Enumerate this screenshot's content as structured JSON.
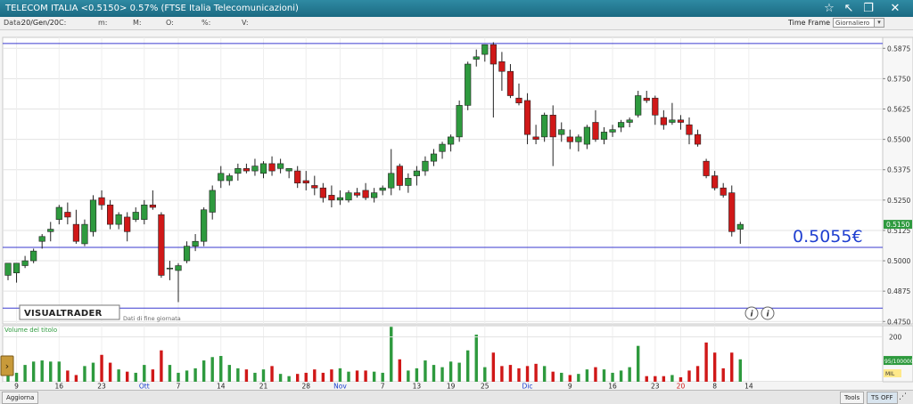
{
  "window": {
    "title": "TELECOM ITALIA <0.5150> 0.57% (FTSE Italia Telecomunicazioni)",
    "icons": [
      "star-icon",
      "pin-icon",
      "restore-icon",
      "close-icon"
    ]
  },
  "infobar": {
    "data_label": "Data:",
    "data_value": "20/Gen/20",
    "c_label": "C:",
    "m_label": "m:",
    "M_label": "M:",
    "o_label": "O:",
    "pct_label": "%:",
    "v_label": "V:",
    "timeframe_label": "Time Frame",
    "timeframe_value": "Giornaliero"
  },
  "overlay": {
    "brand": "VISUALTRADER",
    "note": "Dati di fine giornata",
    "price_callout": "0.5055€",
    "info_glyph": "i"
  },
  "statusbar": {
    "update_label": "Aggiorna",
    "tools_label": "Tools",
    "tsoff_label": "TS OFF"
  },
  "chart_data": {
    "type": "candlestick",
    "price_axis": {
      "ticks": [
        "0.5875",
        "0.5750",
        "0.5625",
        "0.5500",
        "0.5375",
        "0.5250",
        "0.5125",
        "0.5000",
        "0.4875",
        "0.4750"
      ],
      "ylim": [
        0.474,
        0.592
      ],
      "last_price_label": "0.5150"
    },
    "hlines": [
      0.5895,
      0.5055,
      0.4805
    ],
    "volume_panel": {
      "title": "Volume del titolo",
      "ticks": [
        "200"
      ],
      "ylim": [
        0,
        250
      ],
      "last_label": "95/100000",
      "unit_label": "MIL"
    },
    "x_labels": [
      {
        "text": "9",
        "i": 1
      },
      {
        "text": "16",
        "i": 6
      },
      {
        "text": "23",
        "i": 11
      },
      {
        "text": "Ott",
        "i": 16,
        "accent": true
      },
      {
        "text": "7",
        "i": 20
      },
      {
        "text": "14",
        "i": 25
      },
      {
        "text": "21",
        "i": 30
      },
      {
        "text": "28",
        "i": 35
      },
      {
        "text": "Nov",
        "i": 39,
        "accent": true
      },
      {
        "text": "7",
        "i": 44
      },
      {
        "text": "13",
        "i": 48
      },
      {
        "text": "19",
        "i": 52
      },
      {
        "text": "25",
        "i": 56
      },
      {
        "text": "Dic",
        "i": 61,
        "accent": true
      },
      {
        "text": "9",
        "i": 66
      },
      {
        "text": "16",
        "i": 71
      },
      {
        "text": "23",
        "i": 76
      },
      {
        "text": "20",
        "i": 79,
        "red": true
      },
      {
        "text": "8",
        "i": 83
      },
      {
        "text": "14",
        "i": 87
      }
    ],
    "candles": [
      {
        "o": 0.494,
        "h": 0.499,
        "l": 0.492,
        "c": 0.499,
        "v": 55
      },
      {
        "o": 0.495,
        "h": 0.499,
        "l": 0.491,
        "c": 0.499,
        "v": 40
      },
      {
        "o": 0.498,
        "h": 0.502,
        "l": 0.497,
        "c": 0.5,
        "v": 75
      },
      {
        "o": 0.5,
        "h": 0.505,
        "l": 0.499,
        "c": 0.504,
        "v": 90
      },
      {
        "o": 0.508,
        "h": 0.511,
        "l": 0.505,
        "c": 0.51,
        "v": 95
      },
      {
        "o": 0.512,
        "h": 0.516,
        "l": 0.508,
        "c": 0.513,
        "v": 90
      },
      {
        "o": 0.517,
        "h": 0.523,
        "l": 0.515,
        "c": 0.522,
        "v": 90
      },
      {
        "o": 0.52,
        "h": 0.524,
        "l": 0.515,
        "c": 0.518,
        "v": 50
      },
      {
        "o": 0.515,
        "h": 0.521,
        "l": 0.507,
        "c": 0.508,
        "v": 30
      },
      {
        "o": 0.507,
        "h": 0.517,
        "l": 0.506,
        "c": 0.515,
        "v": 70
      },
      {
        "o": 0.512,
        "h": 0.527,
        "l": 0.51,
        "c": 0.525,
        "v": 85
      },
      {
        "o": 0.526,
        "h": 0.529,
        "l": 0.521,
        "c": 0.523,
        "v": 120
      },
      {
        "o": 0.523,
        "h": 0.525,
        "l": 0.513,
        "c": 0.515,
        "v": 85
      },
      {
        "o": 0.515,
        "h": 0.52,
        "l": 0.513,
        "c": 0.519,
        "v": 55
      },
      {
        "o": 0.518,
        "h": 0.52,
        "l": 0.508,
        "c": 0.512,
        "v": 45
      },
      {
        "o": 0.517,
        "h": 0.522,
        "l": 0.516,
        "c": 0.52,
        "v": 40
      },
      {
        "o": 0.517,
        "h": 0.525,
        "l": 0.515,
        "c": 0.523,
        "v": 75
      },
      {
        "o": 0.523,
        "h": 0.529,
        "l": 0.521,
        "c": 0.522,
        "v": 55
      },
      {
        "o": 0.519,
        "h": 0.52,
        "l": 0.493,
        "c": 0.494,
        "v": 140
      },
      {
        "o": 0.497,
        "h": 0.5,
        "l": 0.492,
        "c": 0.497,
        "v": 75
      },
      {
        "o": 0.496,
        "h": 0.499,
        "l": 0.483,
        "c": 0.498,
        "v": 40
      },
      {
        "o": 0.5,
        "h": 0.508,
        "l": 0.499,
        "c": 0.506,
        "v": 50
      },
      {
        "o": 0.506,
        "h": 0.511,
        "l": 0.504,
        "c": 0.508,
        "v": 60
      },
      {
        "o": 0.508,
        "h": 0.522,
        "l": 0.506,
        "c": 0.521,
        "v": 95
      },
      {
        "o": 0.52,
        "h": 0.531,
        "l": 0.517,
        "c": 0.529,
        "v": 110
      },
      {
        "o": 0.533,
        "h": 0.539,
        "l": 0.53,
        "c": 0.536,
        "v": 115
      },
      {
        "o": 0.533,
        "h": 0.536,
        "l": 0.531,
        "c": 0.535,
        "v": 75
      },
      {
        "o": 0.536,
        "h": 0.54,
        "l": 0.533,
        "c": 0.538,
        "v": 60
      },
      {
        "o": 0.538,
        "h": 0.54,
        "l": 0.536,
        "c": 0.537,
        "v": 55
      },
      {
        "o": 0.537,
        "h": 0.542,
        "l": 0.535,
        "c": 0.539,
        "v": 40
      },
      {
        "o": 0.536,
        "h": 0.541,
        "l": 0.534,
        "c": 0.54,
        "v": 55
      },
      {
        "o": 0.54,
        "h": 0.543,
        "l": 0.535,
        "c": 0.537,
        "v": 70
      },
      {
        "o": 0.538,
        "h": 0.542,
        "l": 0.536,
        "c": 0.54,
        "v": 35
      },
      {
        "o": 0.537,
        "h": 0.538,
        "l": 0.534,
        "c": 0.538,
        "v": 25
      },
      {
        "o": 0.537,
        "h": 0.539,
        "l": 0.53,
        "c": 0.532,
        "v": 35
      },
      {
        "o": 0.533,
        "h": 0.537,
        "l": 0.529,
        "c": 0.532,
        "v": 40
      },
      {
        "o": 0.531,
        "h": 0.535,
        "l": 0.527,
        "c": 0.53,
        "v": 55
      },
      {
        "o": 0.53,
        "h": 0.532,
        "l": 0.524,
        "c": 0.526,
        "v": 40
      },
      {
        "o": 0.527,
        "h": 0.531,
        "l": 0.522,
        "c": 0.525,
        "v": 55
      },
      {
        "o": 0.525,
        "h": 0.529,
        "l": 0.523,
        "c": 0.526,
        "v": 60
      },
      {
        "o": 0.525,
        "h": 0.529,
        "l": 0.524,
        "c": 0.528,
        "v": 45
      },
      {
        "o": 0.528,
        "h": 0.53,
        "l": 0.526,
        "c": 0.527,
        "v": 50
      },
      {
        "o": 0.529,
        "h": 0.532,
        "l": 0.525,
        "c": 0.526,
        "v": 50
      },
      {
        "o": 0.526,
        "h": 0.53,
        "l": 0.524,
        "c": 0.528,
        "v": 45
      },
      {
        "o": 0.529,
        "h": 0.531,
        "l": 0.527,
        "c": 0.53,
        "v": 40
      },
      {
        "o": 0.53,
        "h": 0.546,
        "l": 0.527,
        "c": 0.536,
        "v": 245
      },
      {
        "o": 0.539,
        "h": 0.54,
        "l": 0.529,
        "c": 0.531,
        "v": 100
      },
      {
        "o": 0.531,
        "h": 0.536,
        "l": 0.528,
        "c": 0.534,
        "v": 50
      },
      {
        "o": 0.535,
        "h": 0.539,
        "l": 0.531,
        "c": 0.537,
        "v": 60
      },
      {
        "o": 0.537,
        "h": 0.543,
        "l": 0.535,
        "c": 0.541,
        "v": 95
      },
      {
        "o": 0.541,
        "h": 0.546,
        "l": 0.539,
        "c": 0.544,
        "v": 75
      },
      {
        "o": 0.545,
        "h": 0.549,
        "l": 0.542,
        "c": 0.548,
        "v": 65
      },
      {
        "o": 0.548,
        "h": 0.552,
        "l": 0.545,
        "c": 0.551,
        "v": 90
      },
      {
        "o": 0.551,
        "h": 0.566,
        "l": 0.549,
        "c": 0.564,
        "v": 85
      },
      {
        "o": 0.564,
        "h": 0.582,
        "l": 0.562,
        "c": 0.581,
        "v": 140
      },
      {
        "o": 0.583,
        "h": 0.587,
        "l": 0.58,
        "c": 0.584,
        "v": 210
      },
      {
        "o": 0.585,
        "h": 0.589,
        "l": 0.582,
        "c": 0.589,
        "v": 65
      },
      {
        "o": 0.589,
        "h": 0.59,
        "l": 0.559,
        "c": 0.581,
        "v": 130
      },
      {
        "o": 0.582,
        "h": 0.586,
        "l": 0.57,
        "c": 0.578,
        "v": 70
      },
      {
        "o": 0.578,
        "h": 0.581,
        "l": 0.567,
        "c": 0.568,
        "v": 75
      },
      {
        "o": 0.567,
        "h": 0.573,
        "l": 0.564,
        "c": 0.565,
        "v": 60
      },
      {
        "o": 0.566,
        "h": 0.569,
        "l": 0.548,
        "c": 0.552,
        "v": 70
      },
      {
        "o": 0.551,
        "h": 0.556,
        "l": 0.548,
        "c": 0.55,
        "v": 80
      },
      {
        "o": 0.551,
        "h": 0.561,
        "l": 0.549,
        "c": 0.56,
        "v": 70
      },
      {
        "o": 0.56,
        "h": 0.564,
        "l": 0.539,
        "c": 0.551,
        "v": 45
      },
      {
        "o": 0.552,
        "h": 0.557,
        "l": 0.549,
        "c": 0.554,
        "v": 40
      },
      {
        "o": 0.551,
        "h": 0.554,
        "l": 0.546,
        "c": 0.549,
        "v": 30
      },
      {
        "o": 0.549,
        "h": 0.552,
        "l": 0.545,
        "c": 0.551,
        "v": 35
      },
      {
        "o": 0.548,
        "h": 0.556,
        "l": 0.546,
        "c": 0.555,
        "v": 55
      },
      {
        "o": 0.557,
        "h": 0.562,
        "l": 0.549,
        "c": 0.55,
        "v": 65
      },
      {
        "o": 0.55,
        "h": 0.555,
        "l": 0.548,
        "c": 0.553,
        "v": 55
      },
      {
        "o": 0.553,
        "h": 0.556,
        "l": 0.551,
        "c": 0.554,
        "v": 40
      },
      {
        "o": 0.555,
        "h": 0.558,
        "l": 0.553,
        "c": 0.557,
        "v": 50
      },
      {
        "o": 0.557,
        "h": 0.559,
        "l": 0.555,
        "c": 0.558,
        "v": 65
      },
      {
        "o": 0.56,
        "h": 0.57,
        "l": 0.559,
        "c": 0.568,
        "v": 160
      },
      {
        "o": 0.567,
        "h": 0.57,
        "l": 0.565,
        "c": 0.566,
        "v": 25
      },
      {
        "o": 0.567,
        "h": 0.568,
        "l": 0.556,
        "c": 0.56,
        "v": 25
      },
      {
        "o": 0.559,
        "h": 0.562,
        "l": 0.554,
        "c": 0.556,
        "v": 25
      },
      {
        "o": 0.557,
        "h": 0.565,
        "l": 0.556,
        "c": 0.558,
        "v": 30
      },
      {
        "o": 0.558,
        "h": 0.56,
        "l": 0.554,
        "c": 0.557,
        "v": 20
      },
      {
        "o": 0.556,
        "h": 0.559,
        "l": 0.548,
        "c": 0.552,
        "v": 50
      },
      {
        "o": 0.552,
        "h": 0.554,
        "l": 0.547,
        "c": 0.548,
        "v": 70
      },
      {
        "o": 0.541,
        "h": 0.542,
        "l": 0.534,
        "c": 0.535,
        "v": 175
      },
      {
        "o": 0.535,
        "h": 0.537,
        "l": 0.529,
        "c": 0.53,
        "v": 130
      },
      {
        "o": 0.53,
        "h": 0.532,
        "l": 0.526,
        "c": 0.527,
        "v": 60
      },
      {
        "o": 0.528,
        "h": 0.531,
        "l": 0.51,
        "c": 0.512,
        "v": 130
      },
      {
        "o": 0.513,
        "h": 0.516,
        "l": 0.507,
        "c": 0.515,
        "v": 100
      }
    ]
  }
}
